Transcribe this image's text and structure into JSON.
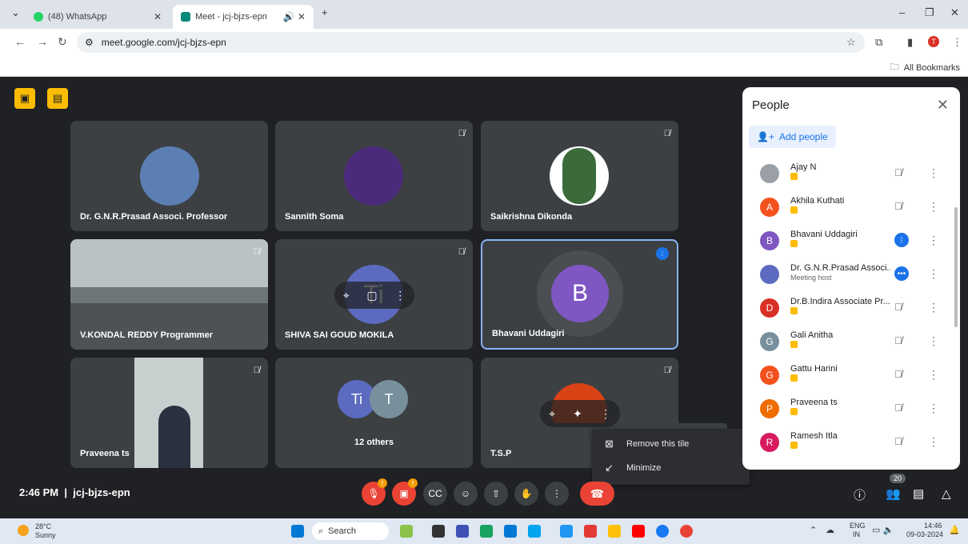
{
  "tabs": [
    {
      "label": "(48) WhatsApp"
    },
    {
      "label": "Meet - jcj-bjzs-epn"
    }
  ],
  "url": "meet.google.com/jcj-bjzs-epn",
  "bookmarks_label": "All Bookmarks",
  "tiles": [
    {
      "name": "Dr. G.N.R.Prasad Associ. Professor"
    },
    {
      "name": "Sannith Soma"
    },
    {
      "name": "Saikrishna Dikonda"
    },
    {
      "name": "V.KONDAL REDDY Programmer"
    },
    {
      "name": "SHIVA SAI GOUD MOKILA",
      "initials": "Ti"
    },
    {
      "name": "Bhavani Uddagiri",
      "initial": "B"
    },
    {
      "name": "Praveena ts"
    },
    {
      "name": "12 others",
      "a1": "Ti",
      "a2": "T"
    },
    {
      "name": "T.S.PI"
    }
  ],
  "people": {
    "title": "People",
    "add": "Add people",
    "list": [
      {
        "name": "Ajay N",
        "initial": "",
        "color": "#9aa0a6"
      },
      {
        "name": "Akhila Kuthati",
        "initial": "A",
        "color": "#f4511e"
      },
      {
        "name": "Bhavani Uddagiri",
        "initial": "B",
        "color": "#7e57c2"
      },
      {
        "name": "Dr. G.N.R.Prasad Associ...",
        "sub": "Meeting host",
        "initial": "",
        "color": "#5c6bc0"
      },
      {
        "name": "Dr.B.Indira Associate Pr...",
        "initial": "D",
        "color": "#d93025"
      },
      {
        "name": "Gali Anitha",
        "initial": "G",
        "color": "#78909c"
      },
      {
        "name": "Gattu Harini",
        "initial": "G",
        "color": "#f4511e"
      },
      {
        "name": "Praveena ts",
        "initial": "P",
        "color": "#ef6c00"
      },
      {
        "name": "Ramesh Itla",
        "initial": "R",
        "color": "#d81b60"
      }
    ]
  },
  "menu": {
    "remove": "Remove this tile",
    "minimize": "Minimize"
  },
  "footer": {
    "time": "2:46 PM",
    "code": "jcj-bjzs-epn",
    "count": "20"
  },
  "taskbar": {
    "temp": "28°C",
    "weather": "Sunny",
    "search": "Search",
    "lang": "ENG",
    "region": "IN",
    "clock": "14:46",
    "date": "09-03-2024"
  }
}
